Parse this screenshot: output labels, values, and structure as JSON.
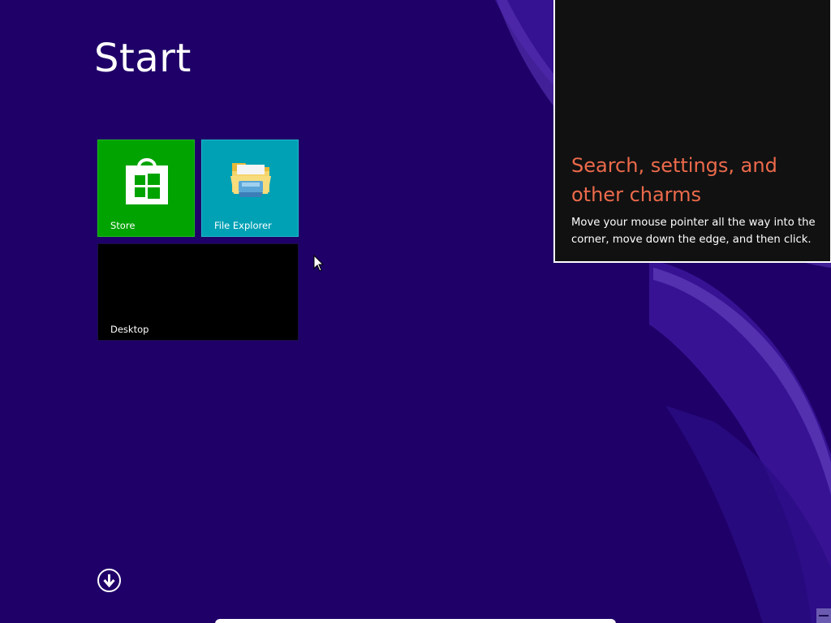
{
  "screen": {
    "title": "Start",
    "background_color": "#1f0068"
  },
  "tiles": [
    {
      "id": "store",
      "label": "Store",
      "color": "#00a300",
      "icon": "store-bag-icon"
    },
    {
      "id": "file-explorer",
      "label": "File Explorer",
      "color": "#00a1b5",
      "icon": "folder-icon"
    },
    {
      "id": "desktop",
      "label": "Desktop",
      "color": "#000000"
    }
  ],
  "charms_tip": {
    "heading": "Search, settings, and other charms",
    "body": "Move your mouse pointer all the way into the corner, move down the edge, and then click.",
    "heading_color": "#ec6a4b",
    "background_color": "#111111"
  },
  "apps_button": {
    "icon": "down-arrow-circle-icon"
  }
}
